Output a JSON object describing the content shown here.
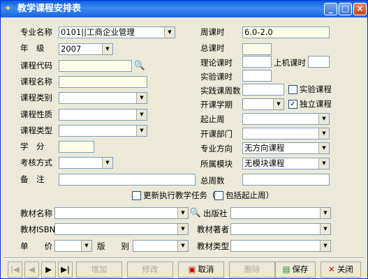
{
  "window": {
    "title": "教学课程安排表",
    "min": "_",
    "max": "□",
    "close": "×"
  },
  "left": {
    "major_label": "专业名称",
    "major_value": "0101||工商企业管理",
    "grade_label": "年　级",
    "grade_value": "2007",
    "course_code_label": "课程代码",
    "course_code_value": "",
    "course_name_label": "课程名称",
    "course_name_value": "",
    "course_category_label": "课程类别",
    "course_nature_label": "课程性质",
    "course_type_label": "课程类型",
    "credit_label": "学　分",
    "exam_method_label": "考核方式",
    "remark_label": "备　注"
  },
  "right": {
    "weekly_hours_label": "周课时",
    "weekly_hours_value": "6.0-2.0",
    "total_hours_label": "总课时",
    "theory_hours_label": "理论课时",
    "lab_hours_label": "上机课时",
    "experiment_hours_label": "实验课时",
    "practice_weeks_label": "实践课周数",
    "experiment_course_label": "实验课程",
    "open_semester_label": "开课学期",
    "independent_course_label": "独立课程",
    "independent_course_checked": true,
    "start_end_week_label": "起止周",
    "open_dept_label": "开课部门",
    "direction_label": "专业方向",
    "direction_value": "无方向课程",
    "module_label": "所属模块",
    "module_value": "无模块课程",
    "total_weeks_label": "总周数"
  },
  "update_task_label": "更新执行教学任务（",
  "include_weeks_label": "包括起止周）",
  "bottom": {
    "textbook_name_label": "教材名称",
    "publisher_label": "出版社",
    "isbn_label": "教材ISBN",
    "author_label": "教材著者",
    "price_label": "单　　价",
    "edition_label": "版　　别",
    "textbook_type_label": "教材类型"
  },
  "toolbar": {
    "first": "|◀",
    "prev": "◀",
    "next": "▶",
    "last": "▶|",
    "add": "增加",
    "edit": "修改",
    "cancel": "取消",
    "delete": "删除",
    "save": "保存",
    "close": "关闭"
  },
  "icons": {
    "check": "✓",
    "dropdown": "▼"
  }
}
